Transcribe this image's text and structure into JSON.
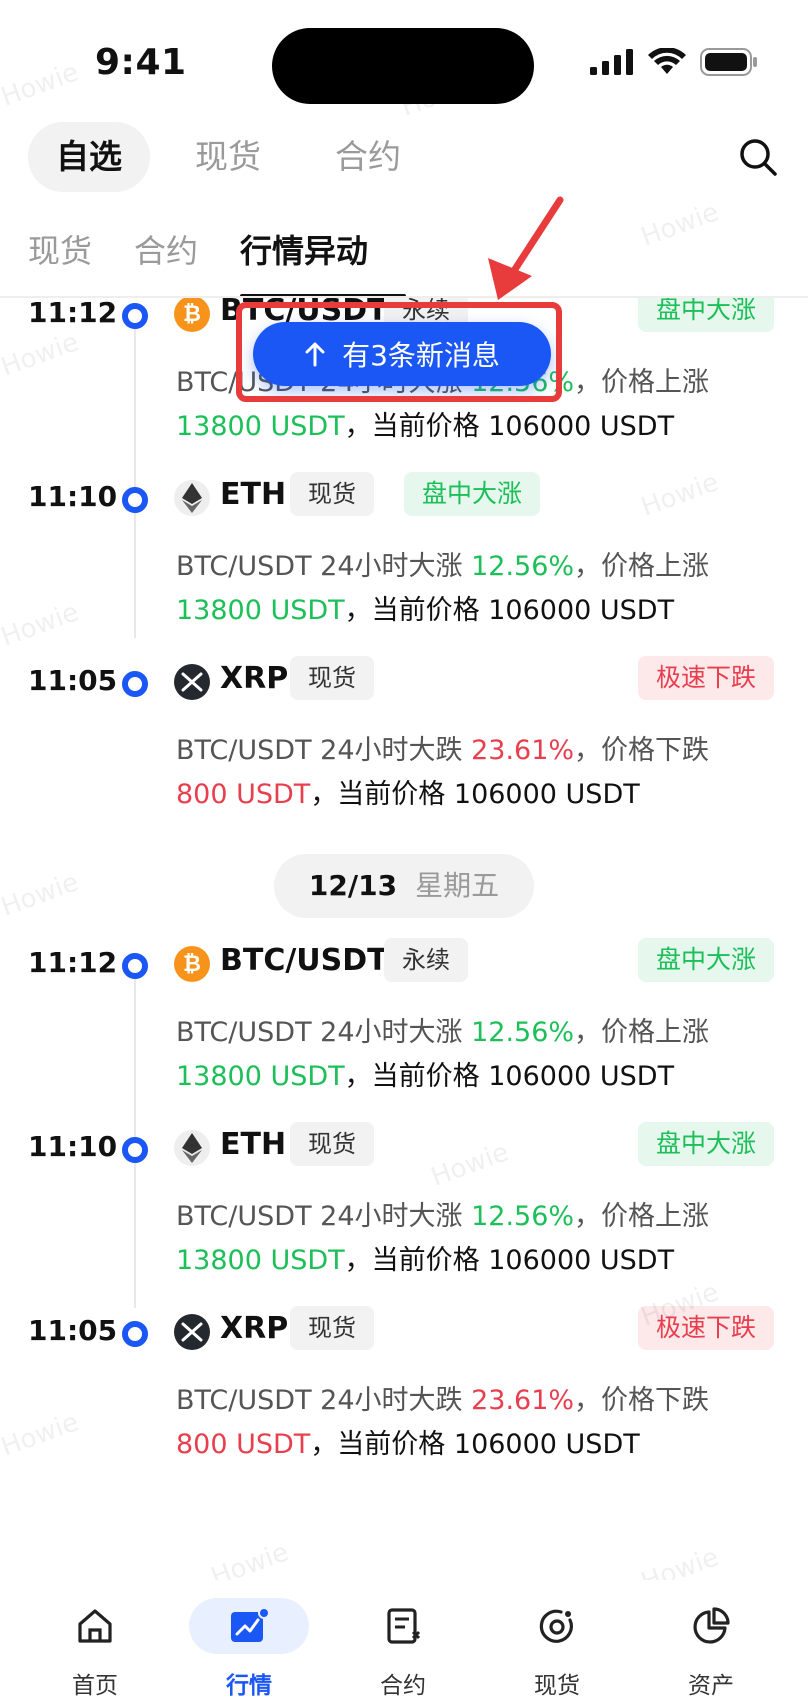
{
  "status_bar": {
    "time": "9:41"
  },
  "top_tabs": [
    {
      "label": "自选",
      "active": true
    },
    {
      "label": "现货",
      "active": false
    },
    {
      "label": "合约",
      "active": false
    }
  ],
  "sub_tabs": [
    {
      "label": "现货",
      "active": false
    },
    {
      "label": "合约",
      "active": false
    },
    {
      "label": "行情异动",
      "active": true
    }
  ],
  "new_message_button": {
    "label": "有3条新消息"
  },
  "date_divider": {
    "date": "12/13",
    "weekday": "星期五"
  },
  "feed": [
    {
      "time": "11:12",
      "coin": "BTC/USDT",
      "icon": "btc-icon",
      "market": "永续",
      "badge": "盘中大涨",
      "direction": "up",
      "text_prefix": "BTC/USDT 24小时大涨 ",
      "change": "12.56%",
      "text_mid": "，价格上涨",
      "amount": "13800 USDT",
      "price_text": "，当前价格 106000 USDT"
    },
    {
      "time": "11:10",
      "coin": "ETH",
      "icon": "eth-icon",
      "market": "现货",
      "badge": "盘中大涨",
      "direction": "up",
      "text_prefix": "BTC/USDT 24小时大涨 ",
      "change": "12.56%",
      "text_mid": "，价格上涨",
      "amount": "13800 USDT",
      "price_text": "，当前价格 106000 USDT"
    },
    {
      "time": "11:05",
      "coin": "XRP",
      "icon": "xrp-icon",
      "market": "现货",
      "badge": "极速下跌",
      "direction": "down",
      "text_prefix": "BTC/USDT 24小时大跌 ",
      "change": "23.61%",
      "text_mid": "，价格下跌",
      "amount": "800 USDT",
      "price_text": "，当前价格 106000 USDT"
    },
    {
      "time": "11:12",
      "coin": "BTC/USDT",
      "icon": "btc-icon",
      "market": "永续",
      "badge": "盘中大涨",
      "direction": "up",
      "text_prefix": "BTC/USDT 24小时大涨 ",
      "change": "12.56%",
      "text_mid": "，价格上涨",
      "amount": "13800 USDT",
      "price_text": "，当前价格 106000 USDT"
    },
    {
      "time": "11:10",
      "coin": "ETH",
      "icon": "eth-icon",
      "market": "现货",
      "badge": "盘中大涨",
      "direction": "up",
      "text_prefix": "BTC/USDT 24小时大涨 ",
      "change": "12.56%",
      "text_mid": "，价格上涨",
      "amount": "13800 USDT",
      "price_text": "，当前价格 106000 USDT"
    },
    {
      "time": "11:05",
      "coin": "XRP",
      "icon": "xrp-icon",
      "market": "现货",
      "badge": "极速下跌",
      "direction": "down",
      "text_prefix": "BTC/USDT 24小时大跌 ",
      "change": "23.61%",
      "text_mid": "，价格下跌",
      "amount": "800 USDT",
      "price_text": "，当前价格 106000 USDT"
    }
  ],
  "watermark": "Howie",
  "bottom_nav": [
    {
      "label": "首页",
      "icon": "home-icon",
      "active": false
    },
    {
      "label": "行情",
      "icon": "market-chart-icon",
      "active": true
    },
    {
      "label": "合约",
      "icon": "contract-icon",
      "active": false
    },
    {
      "label": "现货",
      "icon": "spot-icon",
      "active": false
    },
    {
      "label": "资产",
      "icon": "pie-chart-icon",
      "active": false
    }
  ],
  "colors": {
    "accent": "#1a57f5",
    "up": "#1cbf58",
    "down": "#e83f4e",
    "annotation": "#e83b3b"
  }
}
